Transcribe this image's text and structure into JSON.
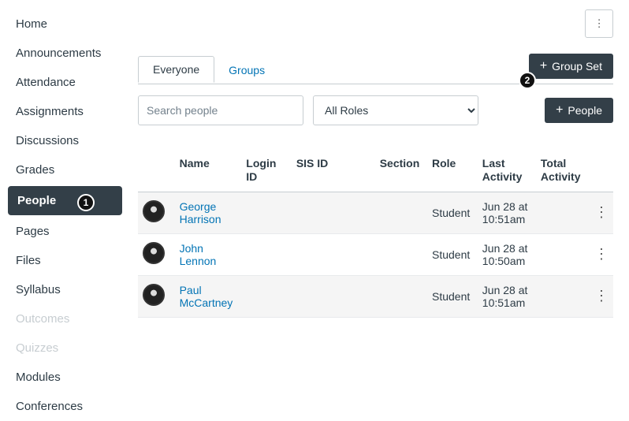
{
  "sidebar": {
    "items": [
      {
        "label": "Home",
        "active": false,
        "disabled": false
      },
      {
        "label": "Announcements",
        "active": false,
        "disabled": false
      },
      {
        "label": "Attendance",
        "active": false,
        "disabled": false
      },
      {
        "label": "Assignments",
        "active": false,
        "disabled": false
      },
      {
        "label": "Discussions",
        "active": false,
        "disabled": false
      },
      {
        "label": "Grades",
        "active": false,
        "disabled": false
      },
      {
        "label": "People",
        "active": true,
        "disabled": false
      },
      {
        "label": "Pages",
        "active": false,
        "disabled": false
      },
      {
        "label": "Files",
        "active": false,
        "disabled": false
      },
      {
        "label": "Syllabus",
        "active": false,
        "disabled": false
      },
      {
        "label": "Outcomes",
        "active": false,
        "disabled": true
      },
      {
        "label": "Quizzes",
        "active": false,
        "disabled": true
      },
      {
        "label": "Modules",
        "active": false,
        "disabled": false
      },
      {
        "label": "Conferences",
        "active": false,
        "disabled": false
      }
    ]
  },
  "tabs": {
    "items": [
      {
        "label": "Everyone",
        "active": true
      },
      {
        "label": "Groups",
        "active": false
      }
    ]
  },
  "buttons": {
    "group_set": "Group Set",
    "people": "People"
  },
  "search": {
    "placeholder": "Search people"
  },
  "role_filter": {
    "selected": "All Roles"
  },
  "table": {
    "headers": {
      "name": "Name",
      "login_id": "Login ID",
      "sis_id": "SIS ID",
      "section": "Section",
      "role": "Role",
      "last_activity": "Last Activity",
      "total_activity": "Total Activity"
    },
    "rows": [
      {
        "name": "George Harrison",
        "login_id": "",
        "sis_id": "",
        "section": "",
        "role": "Student",
        "last_activity": "Jun 28 at 10:51am",
        "total_activity": ""
      },
      {
        "name": "John Lennon",
        "login_id": "",
        "sis_id": "",
        "section": "",
        "role": "Student",
        "last_activity": "Jun 28 at 10:50am",
        "total_activity": ""
      },
      {
        "name": "Paul McCartney",
        "login_id": "",
        "sis_id": "",
        "section": "",
        "role": "Student",
        "last_activity": "Jun 28 at 10:51am",
        "total_activity": ""
      }
    ]
  },
  "callouts": {
    "one": "1",
    "two": "2"
  }
}
